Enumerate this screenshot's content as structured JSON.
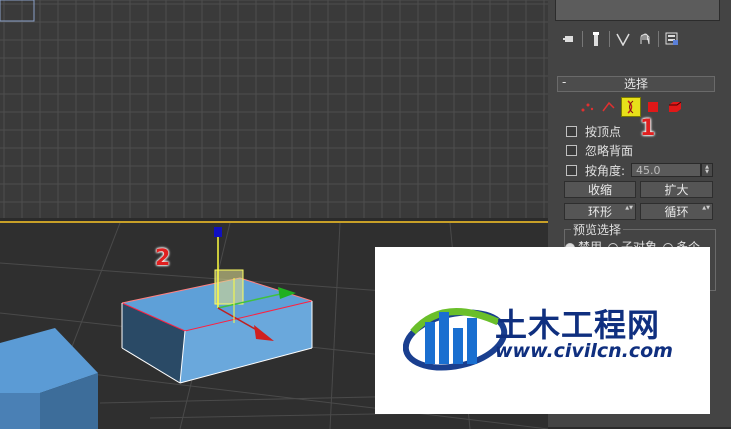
{
  "viewport_top": {
    "name": "top-viewport"
  },
  "viewport_persp": {
    "name": "perspective-viewport"
  },
  "panel": {
    "tabs": [
      "pin-stack-icon",
      "modifier-toggle-icon",
      "show-end-result-icon",
      "make-unique-icon",
      "configure-modifier-sets-icon"
    ],
    "selection_rollout": {
      "title": "选择",
      "collapse_symbol": "-",
      "subobject_icons": [
        "vertex-icon",
        "edge-icon",
        "border-icon",
        "polygon-icon",
        "element-icon"
      ],
      "active_subobject": "border-icon",
      "by_vertex_label": "按顶点",
      "ignore_backfacing_label": "忽略背面",
      "by_angle_label": "按角度:",
      "by_angle_value": "45.0",
      "shrink_label": "收缩",
      "grow_label": "扩大",
      "ring_label": "环形",
      "loop_label": "循环",
      "preview_group_title": "预览选择",
      "preview_options": [
        "禁用",
        "子对象",
        "多个"
      ]
    }
  },
  "annotations": {
    "step1": "1",
    "step2": "2"
  },
  "watermark": {
    "text_cn": "土木工程网",
    "url": "www.civilcn.com"
  },
  "colors": {
    "highlight": "#e8e01a",
    "annotation_red": "#e02020",
    "box_blue": "#5b9bd5",
    "selection_red": "#ff2040"
  }
}
